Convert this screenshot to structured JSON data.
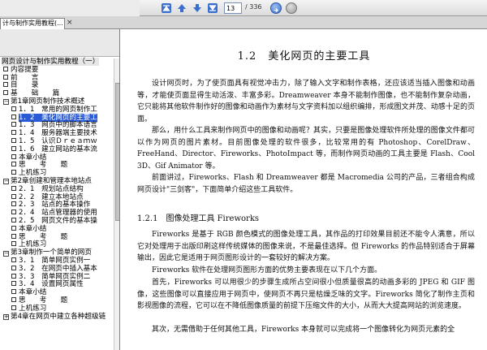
{
  "toolbar": {
    "page_current": "13",
    "page_total": "/ 336",
    "icons": [
      "first-page-icon",
      "previous-page-icon",
      "next-page-icon",
      "last-page-icon",
      "go-icon",
      "zoom-icon"
    ]
  },
  "tab": {
    "label": "计与制作实用教程(...",
    "close": "×"
  },
  "sidebar": {
    "nodes": [
      {
        "label": "网页设计与制作实用教程（一）",
        "level": 0,
        "kind": "root"
      },
      {
        "label": "内容提要",
        "level": 1,
        "kind": "page"
      },
      {
        "label": "前　　言",
        "level": 1,
        "kind": "page"
      },
      {
        "label": "目　　录",
        "level": 1,
        "kind": "page"
      },
      {
        "label": "基　　础　　篇",
        "level": 1,
        "kind": "page"
      },
      {
        "label": "第1章网页制作技术概述",
        "level": 1,
        "kind": "open"
      },
      {
        "label": "1．1　常用的网页制作工",
        "level": 2,
        "kind": "page"
      },
      {
        "label": "1．2　美化网页的主要工",
        "level": 2,
        "kind": "page",
        "selected": true
      },
      {
        "label": "1．3　网页中的脚本语言",
        "level": 2,
        "kind": "page"
      },
      {
        "label": "1．4　服务器端主要技术",
        "level": 2,
        "kind": "page"
      },
      {
        "label": "1．5　认识Ｄｒｅａｍｗ",
        "level": 2,
        "kind": "page"
      },
      {
        "label": "1．6　建立网站的基本流",
        "level": 2,
        "kind": "page"
      },
      {
        "label": "本章小结",
        "level": 2,
        "kind": "page"
      },
      {
        "label": "思　　考　　题",
        "level": 2,
        "kind": "page"
      },
      {
        "label": "上机练习",
        "level": 2,
        "kind": "page"
      },
      {
        "label": "第2章创建和管理本地站点",
        "level": 1,
        "kind": "open"
      },
      {
        "label": "2．1　规划站点结构",
        "level": 2,
        "kind": "page"
      },
      {
        "label": "2．2　建立本地站点",
        "level": 2,
        "kind": "page"
      },
      {
        "label": "2．3　站点的基本操作",
        "level": 2,
        "kind": "page"
      },
      {
        "label": "2．4　站点管理器的使用",
        "level": 2,
        "kind": "page"
      },
      {
        "label": "2．5　网页文件的基本操",
        "level": 2,
        "kind": "page"
      },
      {
        "label": "本章小结",
        "level": 2,
        "kind": "page"
      },
      {
        "label": "思　　考　　题",
        "level": 2,
        "kind": "page"
      },
      {
        "label": "上机练习",
        "level": 2,
        "kind": "page"
      },
      {
        "label": "第3章制作一个简单的网页",
        "level": 1,
        "kind": "open"
      },
      {
        "label": "3．1　简单网页实例一",
        "level": 2,
        "kind": "page"
      },
      {
        "label": "3．2　在网页中插入基本",
        "level": 2,
        "kind": "page"
      },
      {
        "label": "3．3　简单网页实例二",
        "level": 2,
        "kind": "page"
      },
      {
        "label": "3．4　设置网页属性",
        "level": 2,
        "kind": "page"
      },
      {
        "label": "本章小结",
        "level": 2,
        "kind": "page"
      },
      {
        "label": "思　　考　　题",
        "level": 2,
        "kind": "page"
      },
      {
        "label": "上机练习",
        "level": 2,
        "kind": "page"
      },
      {
        "label": "第4章在网页中建立各种超级链",
        "level": 1,
        "kind": "closed"
      }
    ]
  },
  "document": {
    "heading": "1.2　美化网页的主要工具",
    "para1": "设计网页时，为了使页面具有视觉冲击力，除了输入文字和制作表格，还应该适当插入图像和动画等，才能使页面显得生动活泼、丰富多彩。Dreamweaver 本身不能制作图像，也不能制作复杂动画，它只能将其他软件制作好的图像和动画作为素材与文字资料加以组织编排，形成图文并茂、动感十足的页面。",
    "para2": "那么，用什么工具来制作网页中的图像和动画呢？其实，只要是图像处理软件所处理的图像文件都可以作为网页的图片素材。目前图像处理的软件很多，比较常用的有 Photoshop、CorelDraw、FreeHand、Director、Fireworks、PhotoImpact 等，而制作网页动画的工具主要是 Flash、Cool 3D、Gif Animator 等。",
    "para3": "前面讲过，Fireworks、Flash 和 Dreamweaver 都是 Macromedia 公司的产品，三者组合构成网页设计\"三剑客\"，下面简单介绍这些工具软件。",
    "subheading": "1.2.1　图像处理工具 Fireworks",
    "para4": "Fireworks 是基于 RGB 颜色模式的图像处理工具，其作品的打印效果目前还不能令人满意，所以它对处理用于出版印刷这样传统媒体的图像来说，不是最佳选择。但 Fireworks 的作品特别适合于屏幕输出，因此它是适用于网页图形设计的一套较好的解决方案。",
    "para5": "Fireworks 软件在处理网页图形方面的优势主要表现在以下几个方面。",
    "para6": "首先，Fireworks 可以用很少的步骤生成所占空间很小但质量很高的动画多彩的 JPEG 和 GIF 图像，这些图像可以直接应用于网页中，使网页不再只是枯燥乏味的文字。Fireworks 简化了制作主页和影视图像的流程，它可以在不降低图像质量的前提下压缩文件的大小，从而大大提高网站的浏览速度。",
    "para7": "其次，无需借助于任何其他工具，Fireworks 本身就可以完成将一个图像转化为网页元素的全"
  }
}
